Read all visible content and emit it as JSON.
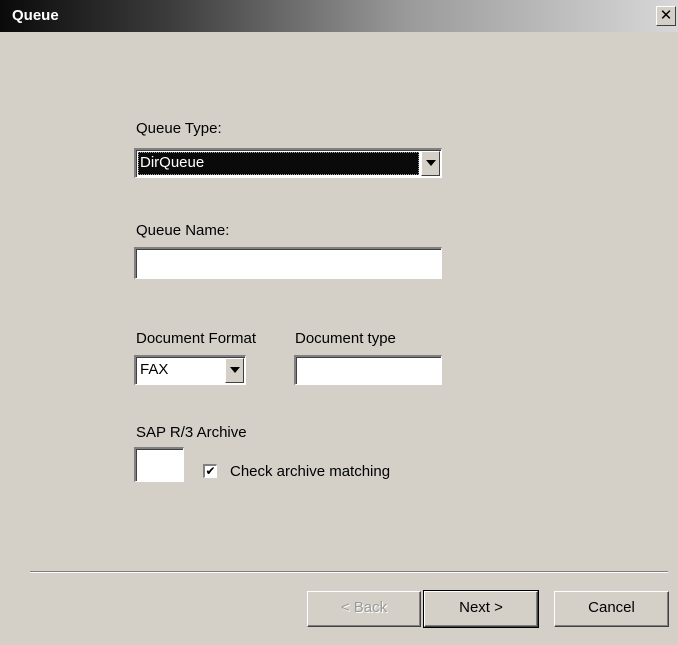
{
  "window": {
    "title": "Queue",
    "close_glyph": "✕"
  },
  "form": {
    "queue_type": {
      "label": "Queue Type:",
      "value": "DirQueue"
    },
    "queue_name": {
      "label": "Queue Name:",
      "value": ""
    },
    "document_format": {
      "label": "Document Format",
      "value": "FAX"
    },
    "document_type": {
      "label": "Document type",
      "value": ""
    },
    "sap_archive": {
      "label": "SAP R/3 Archive",
      "value": ""
    },
    "check_archive": {
      "label": "Check archive matching",
      "checked": true,
      "mark": "✔"
    }
  },
  "buttons": {
    "back": "< Back",
    "next": "Next >",
    "cancel": "Cancel"
  },
  "icons": {
    "close": "close-icon",
    "dropdown": "chevron-down-icon",
    "check": "checkmark-icon"
  }
}
